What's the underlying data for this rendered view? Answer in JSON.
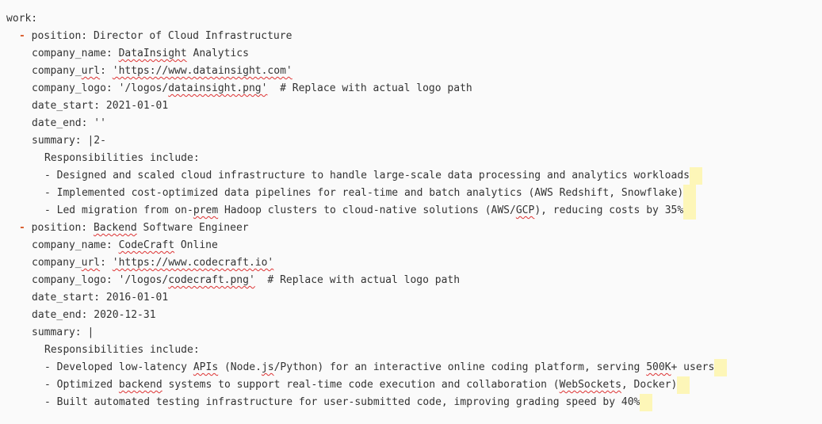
{
  "root_key": "work:",
  "jobs": [
    {
      "position_key": "position: ",
      "position": "Director of Cloud Infrastructure",
      "company_name_key": "company_name: ",
      "company_name_a": "DataInsight",
      "company_name_b": " Analytics",
      "company_url_key_a": "company_",
      "company_url_key_b": "url",
      "company_url_key_c": ": ",
      "company_url_value": "'https://www.datainsight.com'",
      "company_logo_key": "company_logo: ",
      "company_logo_a": "'/logos/",
      "company_logo_b": "datainsight.png'",
      "company_logo_comment": "  # Replace with actual logo path",
      "date_start": "date_start: 2021-01-01",
      "date_end": "date_end: ''",
      "summary": "summary: |2-",
      "resp_header": "Responsibilities include:",
      "bullet1": "- Designed and scaled cloud infrastructure to handle large-scale data processing and analytics workloads",
      "bullet2": "- Implemented cost-optimized data pipelines for real-time and batch analytics (AWS Redshift, Snowflake)",
      "bullet3_a": "- Led migration from on-",
      "bullet3_b": "prem",
      "bullet3_c": " Hadoop clusters to cloud-native solutions (AWS/",
      "bullet3_d": "GCP",
      "bullet3_e": "), reducing costs by 35%"
    },
    {
      "position_key": "position: ",
      "position": "Backend",
      "position_rest": " Software Engineer",
      "company_name_key": "company_name: ",
      "company_name_a": "CodeCraft",
      "company_name_b": " Online",
      "company_url_key_a": "company_",
      "company_url_key_b": "url",
      "company_url_key_c": ": ",
      "company_url_value": "'https://www.codecraft.io'",
      "company_logo_key": "company_logo: ",
      "company_logo_a": "'/logos/",
      "company_logo_b": "codecraft.png'",
      "company_logo_comment": "  # Replace with actual logo path",
      "date_start": "date_start: 2016-01-01",
      "date_end": "date_end: 2020-12-31",
      "summary": "summary: |",
      "resp_header": "Responsibilities include:",
      "bullet1_a": "- Developed low-latency ",
      "bullet1_b": "APIs",
      "bullet1_c": " (Node.",
      "bullet1_d": "js",
      "bullet1_e": "/Python) for an interactive online coding platform, serving ",
      "bullet1_f": "500K",
      "bullet1_g": "+ users",
      "bullet2_a": "- Optimized ",
      "bullet2_b": "backend",
      "bullet2_c": " systems to support real-time code execution and collaboration (",
      "bullet2_d": "WebSockets",
      "bullet2_e": ", Docker)",
      "bullet3": "- Built automated testing infrastructure for user-submitted code, improving grading speed by 40%"
    }
  ],
  "dash": "- "
}
